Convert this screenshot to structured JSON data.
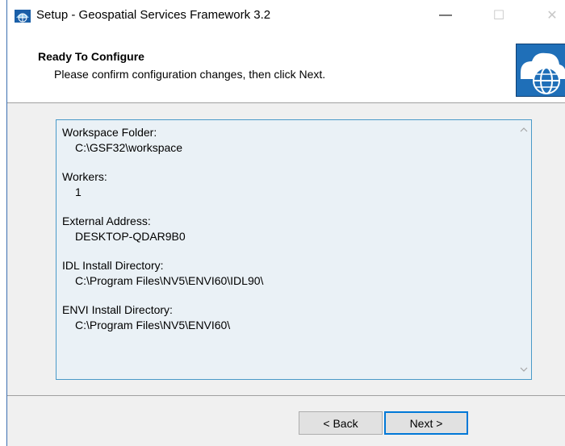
{
  "window": {
    "title": "Setup - Geospatial Services Framework 3.2",
    "icon": "setup-app-icon",
    "controls": {
      "minimize": "—",
      "maximize": "☐",
      "close": "✕"
    }
  },
  "header": {
    "title": "Ready To Configure",
    "subtitle": "Please confirm configuration changes, then click Next.",
    "logo": "globe-cloud-logo"
  },
  "summary": {
    "entries": [
      {
        "label": "Workspace Folder:",
        "value": "C:\\GSF32\\workspace"
      },
      {
        "label": "Workers:",
        "value": "1"
      },
      {
        "label": "External Address:",
        "value": "DESKTOP-QDAR9B0"
      },
      {
        "label": "IDL Install Directory:",
        "value": "C:\\Program Files\\NV5\\ENVI60\\IDL90\\"
      },
      {
        "label": "ENVI Install Directory:",
        "value": "C:\\Program Files\\NV5\\ENVI60\\"
      }
    ]
  },
  "buttons": {
    "back": "< Back",
    "next": "Next >"
  },
  "colors": {
    "accent": "#0078d7",
    "box_border": "#4a9ac8",
    "box_bg": "#eaf1f6"
  }
}
